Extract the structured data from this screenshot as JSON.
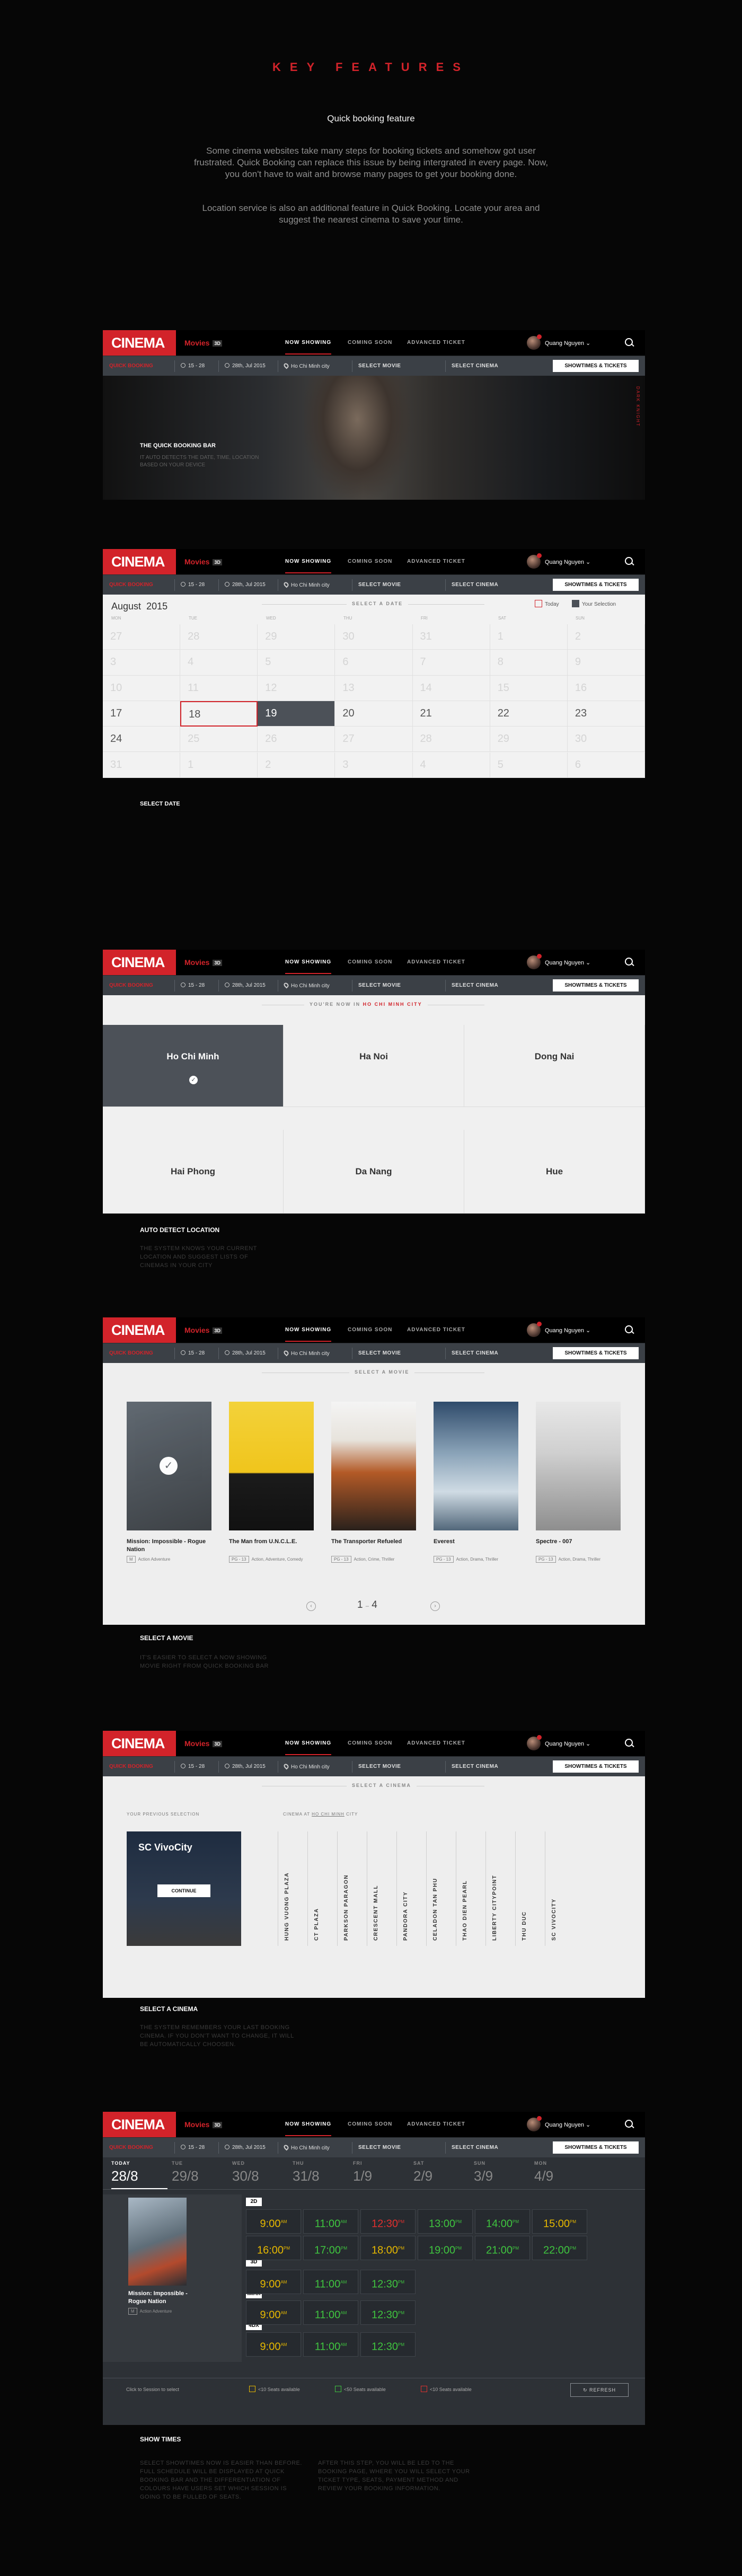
{
  "intro": {
    "title": "KEY FEATURES",
    "subtitle": "Quick booking feature",
    "p1": "Some cinema websites take many steps for booking tickets and somehow got user frustrated. Quick Booking can replace this issue by being intergrated in every page. Now, you don't have to wait and browse many pages to get your booking done.",
    "p2": "Location service is also an additional feature in Quick Booking. Locate your area and suggest the nearest cinema to save your time."
  },
  "app": {
    "logo": "CINEMA",
    "movies": "Movies",
    "movies_badge": "3D",
    "nav": [
      "NOW SHOWING",
      "COMING SOON",
      "ADVANCED TICKET"
    ],
    "user": "Quang Nguyen",
    "bar": {
      "label": "QUICK BOOKING",
      "week": "15 - 28",
      "date": "28th, Jul 2015",
      "city": "Ho Chi Minh city",
      "movie": "SELECT MOVIE",
      "cinema": "SELECT CINEMA",
      "button": "SHOWTIMES & TICKETS"
    }
  },
  "s1": {
    "title": "THE QUICK BOOKING BAR",
    "desc": "IT AUTO DETECTS THE DATE, TIME, LOCATION BASED ON YOUR DEVICE",
    "side": "DARK KNIGHT"
  },
  "s2": {
    "month": "August",
    "year": "2015",
    "header": "SELECT A DATE",
    "today": "Today",
    "selection": "Your Selection",
    "days": [
      "MON",
      "TUE",
      "WED",
      "THU",
      "FRI",
      "SAT",
      "SUN"
    ],
    "rows": [
      [
        "27",
        "28",
        "29",
        "30",
        "31",
        "1",
        "2"
      ],
      [
        "3",
        "4",
        "5",
        "6",
        "7",
        "8",
        "9"
      ],
      [
        "10",
        "11",
        "12",
        "13",
        "14",
        "15",
        "16"
      ],
      [
        "17",
        "18",
        "19",
        "20",
        "21",
        "22",
        "23"
      ],
      [
        "24",
        "25",
        "26",
        "27",
        "28",
        "29",
        "30"
      ],
      [
        "31",
        "1",
        "2",
        "3",
        "4",
        "5",
        "6"
      ]
    ],
    "caption": "SELECT DATE"
  },
  "s3": {
    "header": "YOU'RE NOW IN",
    "city_now": "HO CHI MINH CITY",
    "cities": [
      "Ho Chi Minh",
      "Ha Noi",
      "Dong Nai",
      "Hai Phong",
      "Da Nang",
      "Hue"
    ],
    "caption": "AUTO DETECT LOCATION",
    "desc": "THE SYSTEM KNOWS YOUR CURRENT LOCATION AND SUGGEST LISTS OF CINEMAS IN YOUR CITY"
  },
  "s4": {
    "header": "SELECT A MOVIE",
    "movies": [
      {
        "title": "Mission: Impossible - Rogue Nation",
        "rating": "M",
        "genre": "Action Adventure"
      },
      {
        "title": "The Man from U.N.C.L.E.",
        "rating": "PG - 13",
        "genre": "Action, Adventure, Comedy"
      },
      {
        "title": "The Transporter Refueled",
        "rating": "PG - 13",
        "genre": "Action, Crime, Thriller"
      },
      {
        "title": "Everest",
        "rating": "PG - 13",
        "genre": "Action, Drama, Thriller"
      },
      {
        "title": "Spectre - 007",
        "rating": "PG - 13",
        "genre": "Action, Drama, Thriller"
      }
    ],
    "pager_cur": "1",
    "pager_total": "4",
    "caption": "SELECT A MOVIE",
    "desc": "IT'S EASIER TO SELECT A NOW SHOWING MOVIE RIGHT FROM QUICK BOOKING BAR"
  },
  "s5": {
    "header": "SELECT A CINEMA",
    "prev": "YOUR PREVIOUS SELECTION",
    "at": "CINEMA AT",
    "at_city": "HO CHI MINH",
    "at_city_tail": "CITY",
    "card": "SC VivoCity",
    "continue": "CONTINUE",
    "cinemas": [
      "HUNG VUONG PLAZA",
      "CT PLAZA",
      "PARKSON PARAGON",
      "CRESCENT MALL",
      "PANDORA CITY",
      "CELADON TAN PHU",
      "THAO DIEN PEARL",
      "LIBERTY CITYPOINT",
      "THU DUC",
      "SC VIVOCITY"
    ],
    "caption": "SELECT A CINEMA",
    "desc": "THE SYSTEM REMEMBERS YOUR LAST BOOKING CINEMA. IF YOU DON'T WANT TO CHANGE, IT WILL BE AUTOMATICALLY CHOOSEN."
  },
  "s6": {
    "days": [
      [
        "TODAY",
        "28/8"
      ],
      [
        "TUE",
        "29/8"
      ],
      [
        "WED",
        "30/8"
      ],
      [
        "THU",
        "31/8"
      ],
      [
        "FRI",
        "1/9"
      ],
      [
        "SAT",
        "2/9"
      ],
      [
        "SUN",
        "3/9"
      ],
      [
        "MON",
        "4/9"
      ]
    ],
    "movie": "Mission: Impossible - Rogue Nation",
    "rating": "M",
    "genre": "Action Adventure",
    "formats": [
      "2D",
      "3D",
      "IMAX",
      "4DX"
    ],
    "times": {
      "a": [
        "9:00",
        "11:00",
        "12:30",
        "13:00",
        "14:00",
        "15:00"
      ],
      "b": [
        "16:00",
        "17:00",
        "18:00",
        "19:00",
        "21:00",
        "22:00"
      ],
      "c": [
        "9:00",
        "11:00",
        "12:30"
      ],
      "d": [
        "9:00",
        "11:00",
        "12:30"
      ],
      "e": [
        "9:00",
        "11:00",
        "12:30"
      ]
    },
    "am": "AM",
    "pm": "PM",
    "legend": [
      "Click to Session to select",
      "<10 Seats available",
      "<50 Seats available",
      "<10 Seats available"
    ],
    "refresh": "REFRESH",
    "caption": "SHOW TIMES",
    "desc1": "SELECT SHOWTIMES NOW IS EASIER THAN BEFORE. FULL SCHEDULE WILL BE DISPLAYED AT QUICK BOOKING BAR AND THE DIFFERENTIATION OF COLOURS HAVE USERS SET WHICH SESSION IS GOING TO BE FULLED OF SEATS.",
    "desc2": "AFTER THIS STEP, YOU WILL BE LED TO THE BOOKING PAGE, WHERE YOU WILL SELECT YOUR TICKET TYPE, SEATS, PAYMENT METHOD AND REVIEW YOUR BOOKING INFORMATION."
  },
  "colors": {
    "accent": "#d2232a",
    "bar": "#3b4046"
  }
}
